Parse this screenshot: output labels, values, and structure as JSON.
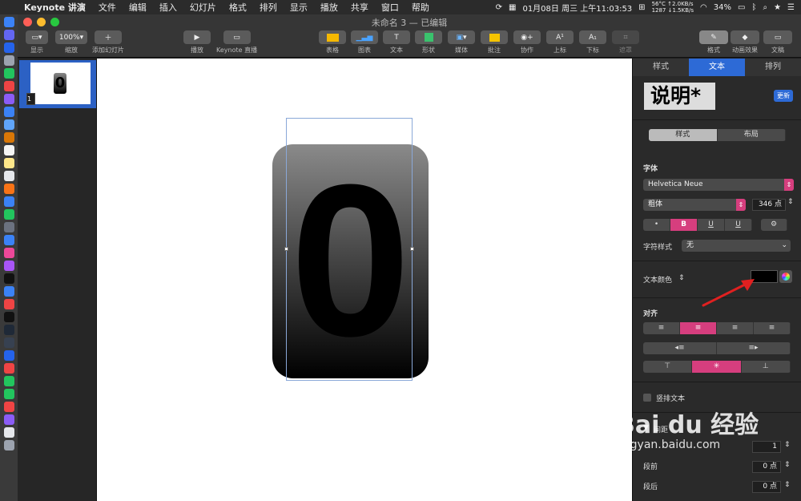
{
  "menubar": {
    "items": [
      "Keynote 讲演",
      "文件",
      "编辑",
      "插入",
      "幻灯片",
      "格式",
      "排列",
      "显示",
      "播放",
      "共享",
      "窗口",
      "帮助"
    ],
    "status": {
      "temp": "56°C",
      "rpm": "1287",
      "up": "↑2.0KB/s",
      "down": "↓1.5KB/s",
      "datetime": "01月08日 周三 上午11:03:53",
      "battery": "34%"
    }
  },
  "window": {
    "title": "未命名 3 — 已编辑",
    "toolbar": {
      "view": "显示",
      "zoom_value": "100%",
      "zoom": "缩放",
      "add_slide": "添加幻灯片",
      "play": "播放",
      "live": "Keynote 直播",
      "table": "表格",
      "chart": "图表",
      "text": "文本",
      "shape": "形状",
      "media": "媒体",
      "comment": "批注",
      "collab": "协作",
      "superscript": "上标",
      "subscript": "下标",
      "mask": "遮罩",
      "format": "格式",
      "animate": "动画效果",
      "document": "文稿"
    }
  },
  "navigator": {
    "slide_number": "1",
    "thumb_glyph": "0"
  },
  "slide": {
    "glyph": "0"
  },
  "inspector": {
    "tabs": [
      "样式",
      "文本",
      "排列"
    ],
    "active_tab": "文本",
    "paragraph_style": "说明*",
    "update": "更新",
    "subtabs": [
      "样式",
      "布局"
    ],
    "font_label": "字体",
    "font_name": "Helvetica Neue",
    "font_weight": "粗体",
    "font_size": "346 点",
    "style_buttons": [
      "•",
      "B",
      "U",
      "U"
    ],
    "gear": "⚙",
    "char_style_label": "字符样式",
    "char_style_value": "无",
    "text_color_label": "文本颜色",
    "text_color": "#000000",
    "align_label": "对齐",
    "vertical_text": "竖排文本",
    "spacing_label": "间距",
    "spacing_value": "1",
    "before_label": "段前",
    "before_value": "0 点",
    "after_label": "段后",
    "after_value": "0 点"
  },
  "watermark": {
    "brand": "Bai du 经验",
    "url": "jingyan.baidu.com"
  },
  "colors": {
    "accent": "#d63e7e",
    "selection": "#2d6ad6",
    "arrow": "#e02020"
  }
}
